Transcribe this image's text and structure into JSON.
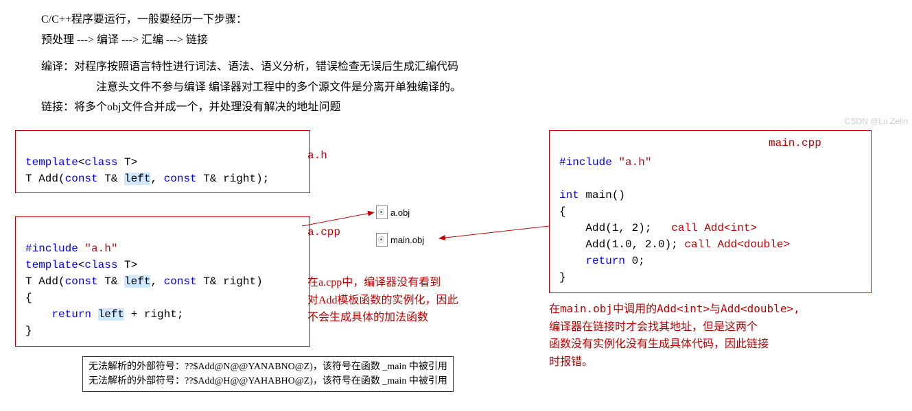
{
  "intro": {
    "l1": "C/C++程序要运行，一般要经历一下步骤：",
    "l2": "预处理 ---> 编译 ---> 汇编 ---> 链接",
    "l3": "编译：对程序按照语言特性进行词法、语法、语义分析，错误检查无误后生成汇编代码",
    "l4": "注意头文件不参与编译  编译器对工程中的多个源文件是分离开单独编译的。",
    "l5": "链接：将多个obj文件合并成一个，并处理没有解决的地址问题"
  },
  "labels": {
    "ah": "a.h",
    "acpp": "a.cpp",
    "maincpp": "main.cpp"
  },
  "obj": {
    "a": "a.obj",
    "main": "main.obj"
  },
  "code_ah": {
    "l1": {
      "a": "template",
      "b": "<",
      "c": "class",
      "d": " T>"
    },
    "l2": {
      "a": "T Add(",
      "b": "const",
      "c": " T& ",
      "d": "left",
      "e": ", ",
      "f": "const",
      "g": " T& right);"
    }
  },
  "code_acpp": {
    "l1": {
      "a": "#include",
      "b": " ",
      "c": "\"a.h\""
    },
    "l2": {
      "a": "template",
      "b": "<",
      "c": "class",
      "d": " T>"
    },
    "l3": {
      "a": "T Add(",
      "b": "const",
      "c": " T& ",
      "d": "left",
      "e": ", ",
      "f": "const",
      "g": " T& right)"
    },
    "l4": "{",
    "l5": {
      "a": "    ",
      "b": "return",
      "c": " ",
      "d": "left",
      "e": " + right;"
    },
    "l6": "}"
  },
  "code_main": {
    "l1": {
      "a": "#include",
      "b": " ",
      "c": "\"a.h\""
    },
    "blank": "",
    "l2": {
      "a": "int",
      "b": " main()"
    },
    "l3": "{",
    "l4": {
      "a": "    Add(1, 2);   ",
      "b": "call Add<int>"
    },
    "l5": {
      "a": "    Add(1.0, 2.0);",
      "b": " call Add<double>"
    },
    "l6": {
      "a": "    ",
      "b": "return",
      "c": " 0;"
    },
    "l7": "}"
  },
  "note_a": {
    "l1": "在a.cpp中，编译器没有看到",
    "l2": "对Add模板函数的实例化，因此",
    "l3": "不会生成具体的加法函数"
  },
  "note_main": {
    "l1": "在main.obj中调用的Add<int>与Add<double>,",
    "l2": "编译器在链接时才会找其地址，但是这两个",
    "l3": "函数没有实例化没有生成具体代码，因此链接",
    "l4": "时报错。"
  },
  "err": {
    "l1": "无法解析的外部符号：??$Add@N@@YANABNO@Z)，该符号在函数 _main 中被引用",
    "l2": "无法解析的外部符号：??$Add@H@@YAHABHO@Z)，该符号在函数 _main 中被引用"
  },
  "watermark": "CSDN @Lu Zelin"
}
